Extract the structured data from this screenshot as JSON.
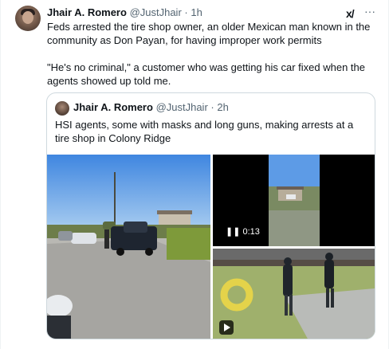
{
  "tweet": {
    "author_name": "Jhair A. Romero",
    "author_handle": "@JustJhair",
    "separator": "·",
    "time": "1h",
    "paragraph_1": "Feds arrested the tire shop owner, an older Mexican man known in the community as Don Payan, for having improper work permits",
    "paragraph_2": "\"He's no criminal,\" a customer who was getting his car fixed when the agents showed up told me.",
    "grok_label": "x/",
    "more_label": "···"
  },
  "quoted_tweet": {
    "author_name": "Jhair A. Romero",
    "author_handle": "@JustJhair",
    "separator": "·",
    "time": "2h",
    "text": "HSI agents, some with masks and long guns, making arrests at a tire shop in Colony Ridge",
    "media": {
      "video_1_duration": "0:13",
      "video_1_state_icon": "pause-icon",
      "video_2_state_icon": "play-icon"
    }
  }
}
